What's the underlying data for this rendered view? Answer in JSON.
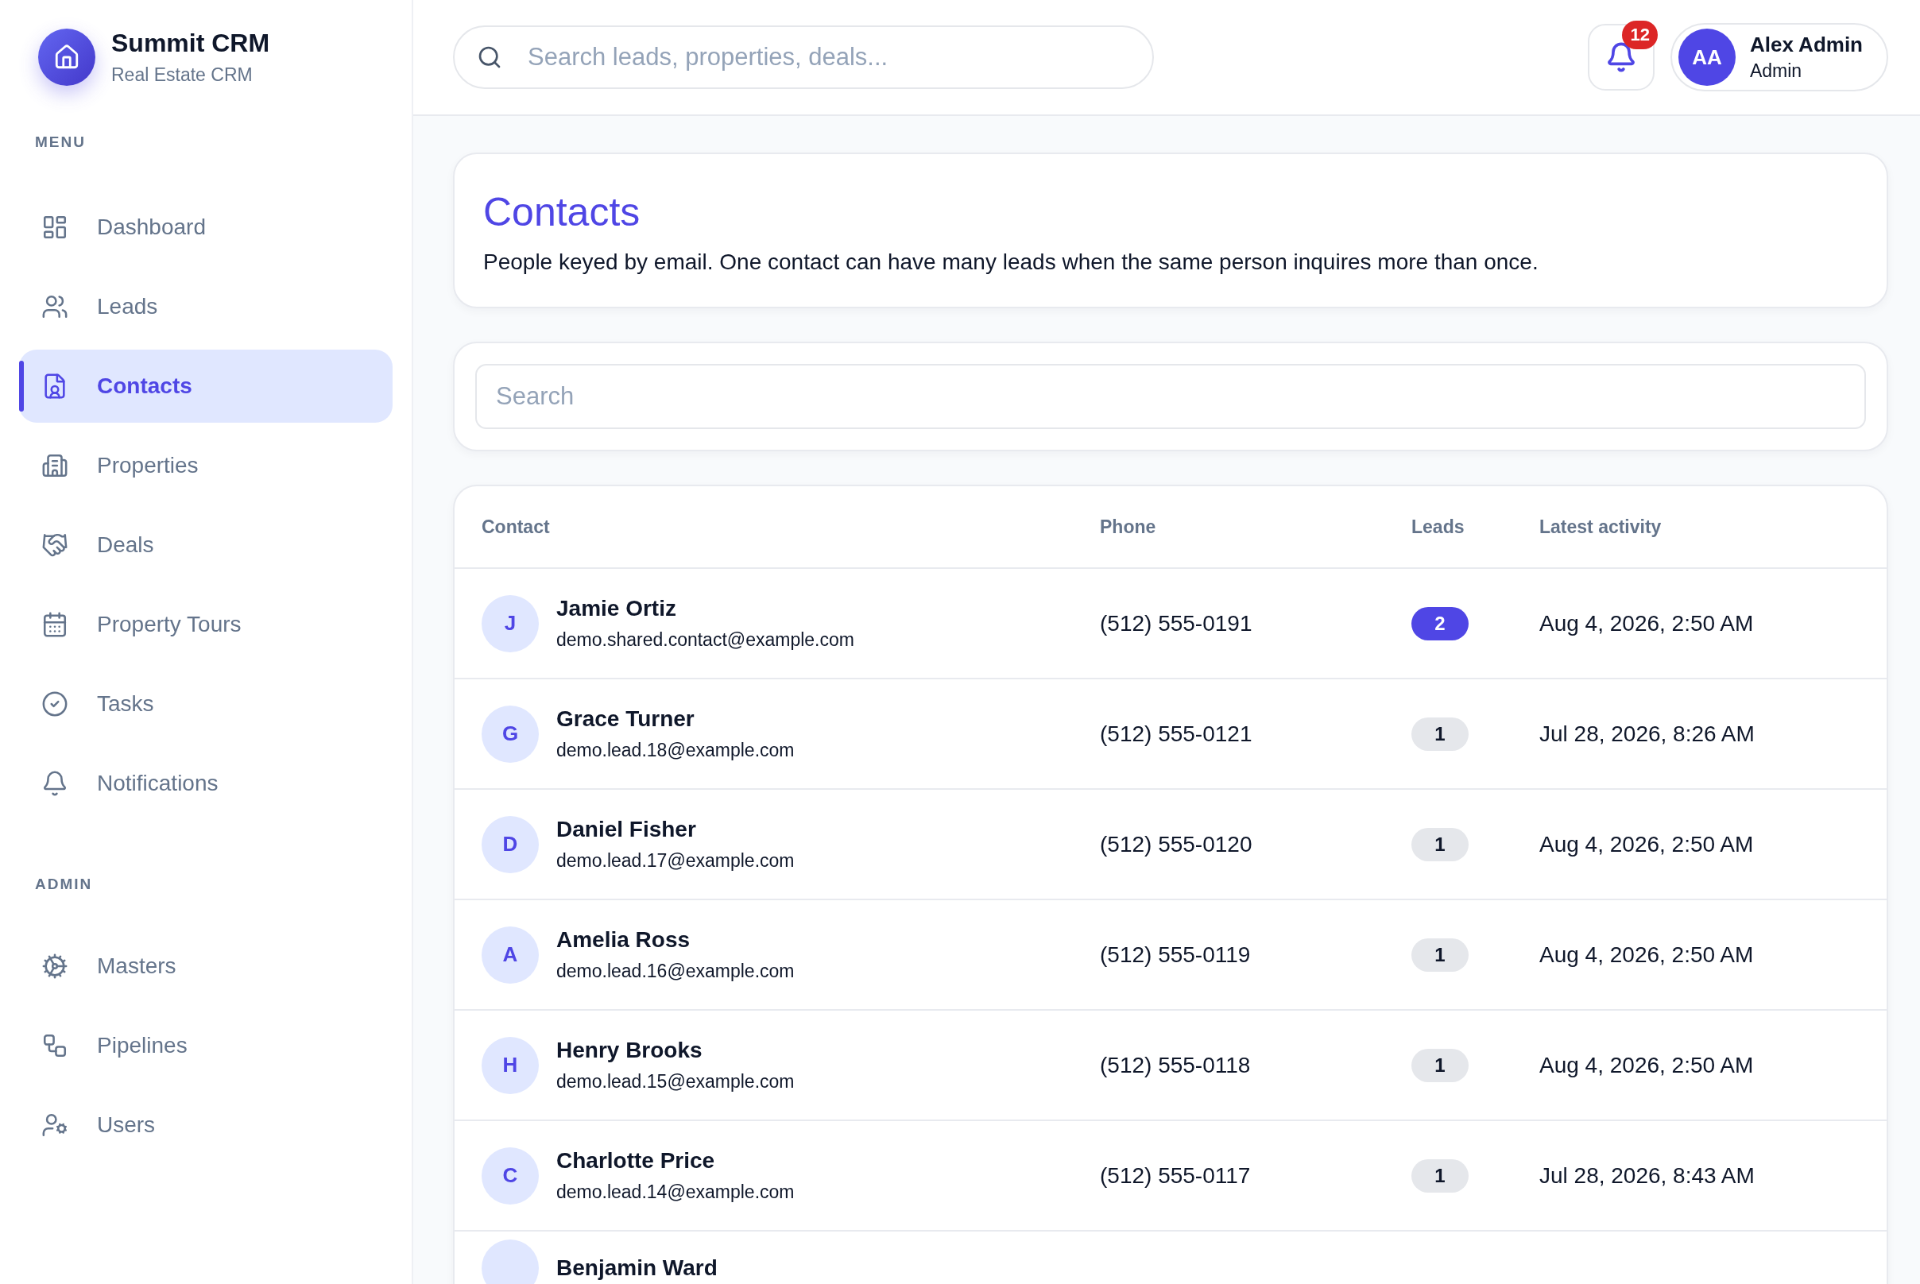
{
  "brand": {
    "title": "Summit CRM",
    "subtitle": "Real Estate CRM"
  },
  "sidebar": {
    "sections": [
      {
        "heading": "MENU",
        "items": [
          {
            "label": "Dashboard",
            "selected": false
          },
          {
            "label": "Leads",
            "selected": false
          },
          {
            "label": "Contacts",
            "selected": true
          },
          {
            "label": "Properties",
            "selected": false
          },
          {
            "label": "Deals",
            "selected": false
          },
          {
            "label": "Property Tours",
            "selected": false
          },
          {
            "label": "Tasks",
            "selected": false
          },
          {
            "label": "Notifications",
            "selected": false
          }
        ]
      },
      {
        "heading": "ADMIN",
        "items": [
          {
            "label": "Masters",
            "selected": false
          },
          {
            "label": "Pipelines",
            "selected": false
          },
          {
            "label": "Users",
            "selected": false
          }
        ]
      }
    ]
  },
  "header": {
    "search": {
      "placeholder": "Search leads, properties, deals..."
    },
    "notifications": {
      "count": "12"
    },
    "user": {
      "initials": "AA",
      "name": "Alex Admin",
      "role": "Admin"
    }
  },
  "page": {
    "title": "Contacts",
    "description": "People keyed by email. One contact can have many leads when the same person inquires more than once."
  },
  "filter": {
    "placeholder": "Search"
  },
  "table": {
    "columns": [
      "Contact",
      "Phone",
      "Leads",
      "Latest activity"
    ],
    "rows": [
      {
        "initial": "J",
        "name": "Jamie Ortiz",
        "email": "demo.shared.contact@example.com",
        "phone": "(512) 555-0191",
        "leads": "2",
        "highlighted": true,
        "latest": "Aug 4, 2026, 2:50 AM"
      },
      {
        "initial": "G",
        "name": "Grace Turner",
        "email": "demo.lead.18@example.com",
        "phone": "(512) 555-0121",
        "leads": "1",
        "highlighted": false,
        "latest": "Jul 28, 2026, 8:26 AM"
      },
      {
        "initial": "D",
        "name": "Daniel Fisher",
        "email": "demo.lead.17@example.com",
        "phone": "(512) 555-0120",
        "leads": "1",
        "highlighted": false,
        "latest": "Aug 4, 2026, 2:50 AM"
      },
      {
        "initial": "A",
        "name": "Amelia Ross",
        "email": "demo.lead.16@example.com",
        "phone": "(512) 555-0119",
        "leads": "1",
        "highlighted": false,
        "latest": "Aug 4, 2026, 2:50 AM"
      },
      {
        "initial": "H",
        "name": "Henry Brooks",
        "email": "demo.lead.15@example.com",
        "phone": "(512) 555-0118",
        "leads": "1",
        "highlighted": false,
        "latest": "Aug 4, 2026, 2:50 AM"
      },
      {
        "initial": "C",
        "name": "Charlotte Price",
        "email": "demo.lead.14@example.com",
        "phone": "(512) 555-0117",
        "leads": "1",
        "highlighted": false,
        "latest": "Jul 28, 2026, 8:43 AM"
      },
      {
        "name": "Benjamin Ward"
      }
    ]
  }
}
